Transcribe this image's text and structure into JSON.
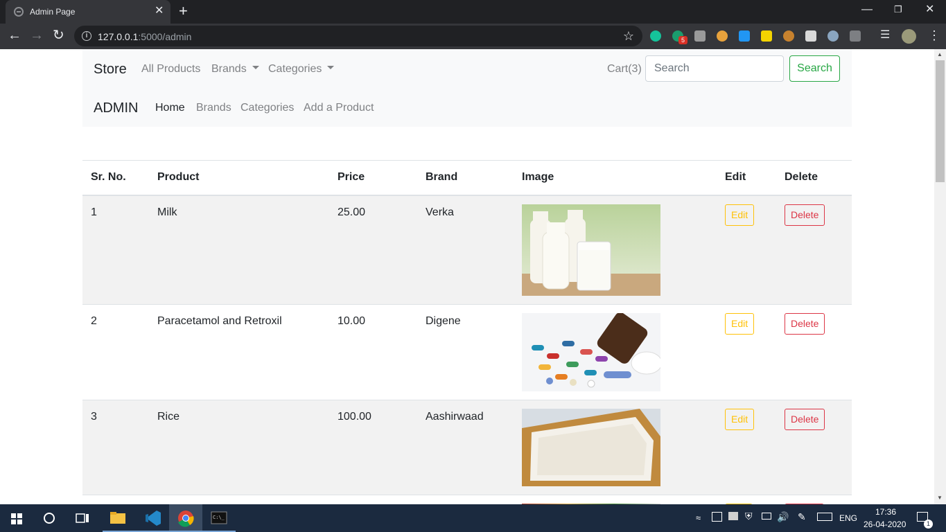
{
  "browser": {
    "tab_title": "Admin Page",
    "tab_close": "✕",
    "new_tab": "+",
    "url_host": "127.0.0.1",
    "url_path": ":5000/admin",
    "extension_badge": "5"
  },
  "store_nav": {
    "brand": "Store",
    "links": [
      "All Products",
      "Brands",
      "Categories"
    ],
    "cart": "Cart(3)",
    "search_placeholder": "Search",
    "search_button": "Search"
  },
  "admin_nav": {
    "brand": "ADMIN",
    "links": [
      "Home",
      "Brands",
      "Categories",
      "Add a Product"
    ]
  },
  "table": {
    "headers": [
      "Sr. No.",
      "Product",
      "Price",
      "Brand",
      "Image",
      "Edit",
      "Delete"
    ],
    "rows": [
      {
        "sr": "1",
        "product": "Milk",
        "price": "25.00",
        "brand": "Verka",
        "image": "milk-bottles-image",
        "edit": "Edit",
        "delete": "Delete"
      },
      {
        "sr": "2",
        "product": "Paracetamol and Retroxil",
        "price": "10.00",
        "brand": "Digene",
        "image": "pills-image",
        "edit": "Edit",
        "delete": "Delete"
      },
      {
        "sr": "3",
        "product": "Rice",
        "price": "100.00",
        "brand": "Aashirwaad",
        "image": "rice-box-image",
        "edit": "Edit",
        "delete": "Delete"
      }
    ]
  },
  "taskbar": {
    "language": "ENG",
    "time": "17:36",
    "date": "26-04-2020",
    "notification_count": "1"
  },
  "colors": {
    "success": "#28a745",
    "warning": "#ffc107",
    "danger": "#dc3545",
    "navbar_bg": "#f8f9fa",
    "chrome_dark": "#202124",
    "taskbar_bg": "#1b2a3f"
  }
}
